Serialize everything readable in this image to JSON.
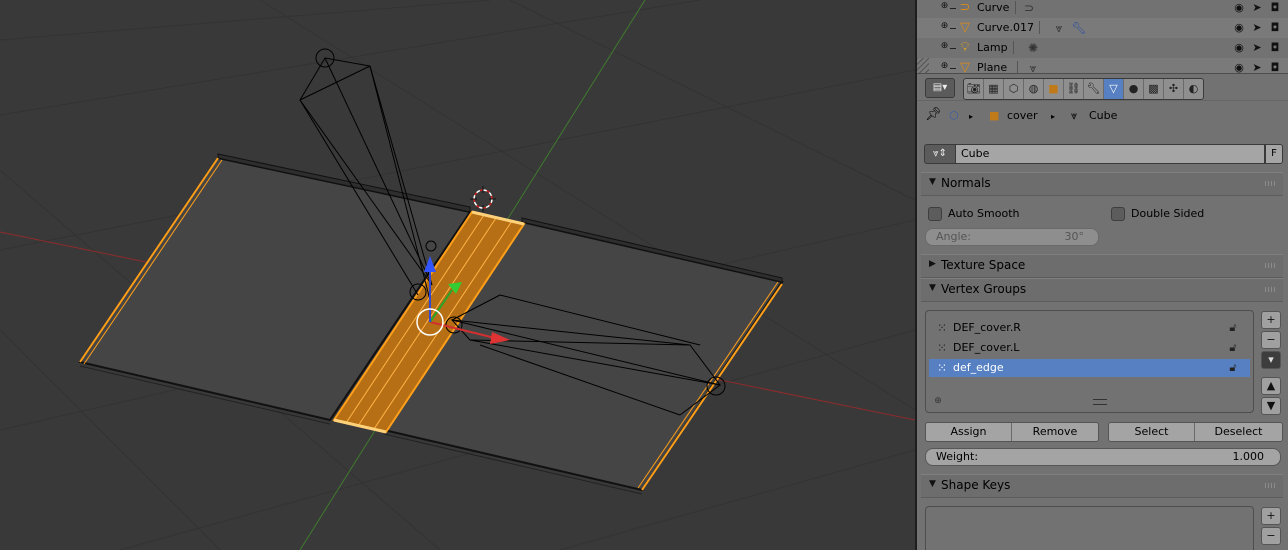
{
  "outliner": {
    "rows": [
      {
        "name": "Curve",
        "icon": "curve-icon",
        "sub_icon": "curve-data-icon"
      },
      {
        "name": "Curve.017",
        "icon": "mesh-object-icon",
        "sub_icon": "mesh-data-icon"
      },
      {
        "name": "Lamp",
        "icon": "lamp-icon",
        "sub_icon": "lamp-data-icon"
      },
      {
        "name": "Plane",
        "icon": "mesh-object-icon",
        "sub_icon": "mesh-data-icon"
      }
    ]
  },
  "properties": {
    "tabs": [
      "render",
      "render-layers",
      "scene",
      "world",
      "object",
      "constraints",
      "modifiers",
      "data",
      "material",
      "texture",
      "particles",
      "physics"
    ],
    "active_tab": "data",
    "breadcrumb": {
      "object": "cover",
      "mesh": "Cube"
    },
    "datablock": {
      "name": "Cube",
      "fake_user": "F"
    },
    "normals": {
      "title": "Normals",
      "auto_smooth": "Auto Smooth",
      "double_sided": "Double Sided",
      "angle_label": "Angle:",
      "angle_value": "30°"
    },
    "texture_space": {
      "title": "Texture Space"
    },
    "vertex_groups": {
      "title": "Vertex Groups",
      "items": [
        "DEF_cover.R",
        "DEF_cover.L",
        "def_edge"
      ],
      "selected": "def_edge",
      "assign": "Assign",
      "remove": "Remove",
      "select": "Select",
      "deselect": "Deselect",
      "weight_label": "Weight:",
      "weight_value": "1.000"
    },
    "shape_keys": {
      "title": "Shape Keys"
    }
  },
  "colors": {
    "viewport_bg": "#393939",
    "selection_orange": "#ff9f1a",
    "active_blue": "#5680c2",
    "axis_x": "#8f2b2b",
    "axis_y": "#3f7a2f"
  }
}
